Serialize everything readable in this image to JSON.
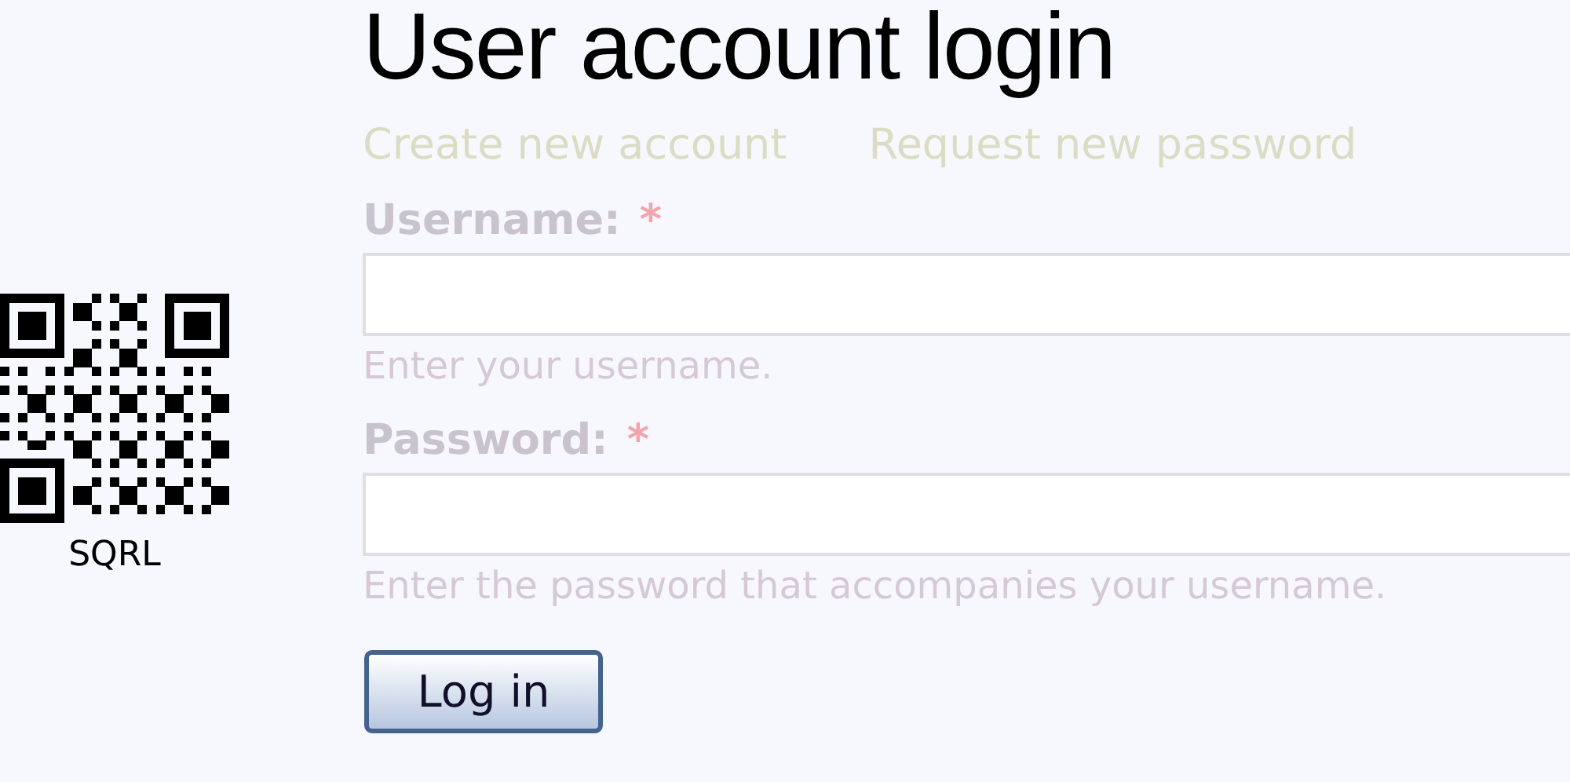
{
  "qr": {
    "caption": "SQRL"
  },
  "title": "User account login",
  "links": [
    "Create new account",
    "Request new password"
  ],
  "fields": [
    {
      "label": "Username:",
      "required_mark": "*",
      "description": "Enter your username."
    },
    {
      "label": "Password:",
      "required_mark": "*",
      "description": "Enter the password that accompanies your username."
    }
  ],
  "button": "Log in"
}
